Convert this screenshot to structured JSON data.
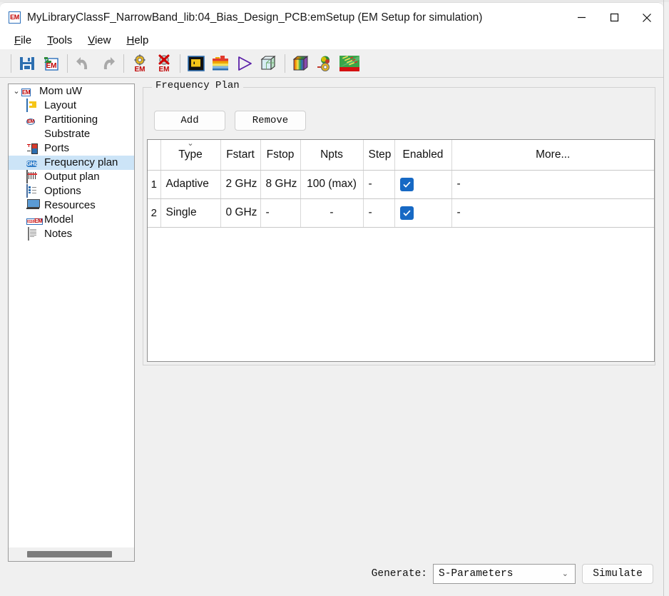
{
  "window": {
    "title": "MyLibraryClassF_NarrowBand_lib:04_Bias_Design_PCB:emSetup (EM Setup for simulation)",
    "app_icon": "EM",
    "minimize_label": "—",
    "maximize_label": "□",
    "close_label": "✕"
  },
  "menubar": {
    "items": [
      {
        "label": "File",
        "mnemonic": "F",
        "rest": "ile"
      },
      {
        "label": "Tools",
        "mnemonic": "T",
        "rest": "ools"
      },
      {
        "label": "View",
        "mnemonic": "V",
        "rest": "iew"
      },
      {
        "label": "Help",
        "mnemonic": "H",
        "rest": "elp"
      }
    ]
  },
  "toolbar": {
    "buttons": [
      {
        "name": "save-icon",
        "tip": "Save"
      },
      {
        "name": "save-em-setup-icon",
        "tip": "Save EM Setup"
      },
      {
        "name": "undo-icon",
        "tip": "Undo"
      },
      {
        "name": "redo-icon",
        "tip": "Redo"
      },
      {
        "name": "em-settings-icon",
        "tip": "EM Settings"
      },
      {
        "name": "em-delete-icon",
        "tip": "Delete EM Setup"
      },
      {
        "name": "layout-icon",
        "tip": "Layout"
      },
      {
        "name": "substrate-icon",
        "tip": "Substrate"
      },
      {
        "name": "simulate-play-icon",
        "tip": "Simulate"
      },
      {
        "name": "3d-preview-icon",
        "tip": "3D Preview"
      },
      {
        "name": "em-cosim-icon",
        "tip": "EM Cosimulation"
      },
      {
        "name": "em-model-icon",
        "tip": "EM Model"
      },
      {
        "name": "visualization-icon",
        "tip": "Visualization"
      }
    ]
  },
  "sidebar": {
    "root": {
      "label": "Mom uW",
      "icon": "em-icon",
      "expanded": true,
      "twisty": "⌄"
    },
    "items": [
      {
        "label": "Layout",
        "icon": "layout-icon",
        "selected": false
      },
      {
        "label": "Partitioning",
        "icon": "partitioning-icon",
        "selected": false
      },
      {
        "label": "Substrate",
        "icon": "substrate-icon",
        "selected": false
      },
      {
        "label": "Ports",
        "icon": "ports-icon",
        "selected": false
      },
      {
        "label": "Frequency plan",
        "icon": "ghz-icon",
        "selected": true
      },
      {
        "label": "Output plan",
        "icon": "output-plan-icon",
        "selected": false
      },
      {
        "label": "Options",
        "icon": "options-icon",
        "selected": false
      },
      {
        "label": "Resources",
        "icon": "resources-icon",
        "selected": false
      },
      {
        "label": "Model",
        "icon": "model-icon",
        "selected": false
      },
      {
        "label": "Notes",
        "icon": "notes-icon",
        "selected": false
      }
    ]
  },
  "main": {
    "group_title": "Frequency Plan",
    "add_label": "Add",
    "remove_label": "Remove",
    "table": {
      "sort_indicator": "⌄",
      "columns": [
        "",
        "Type",
        "Fstart",
        "Fstop",
        "Npts",
        "Step",
        "Enabled",
        "More..."
      ],
      "rows": [
        {
          "num": "1",
          "type": "Adaptive",
          "fstart": "2 GHz",
          "fstop": "8 GHz",
          "npts": "100 (max)",
          "step": "-",
          "enabled": true,
          "more": "-"
        },
        {
          "num": "2",
          "type": "Single",
          "fstart": "0 GHz",
          "fstop": "-",
          "npts": "-",
          "step": "-",
          "enabled": true,
          "more": "-"
        }
      ]
    }
  },
  "footer": {
    "generate_label": "Generate:",
    "generate_value": "S-Parameters",
    "generate_arrow": "⌄",
    "simulate_label": "Simulate"
  },
  "colors": {
    "accent": "#1769c4",
    "selection": "#cce4f7",
    "window_bg": "#f0f0f0",
    "titlebar_bg": "#ffffff"
  }
}
